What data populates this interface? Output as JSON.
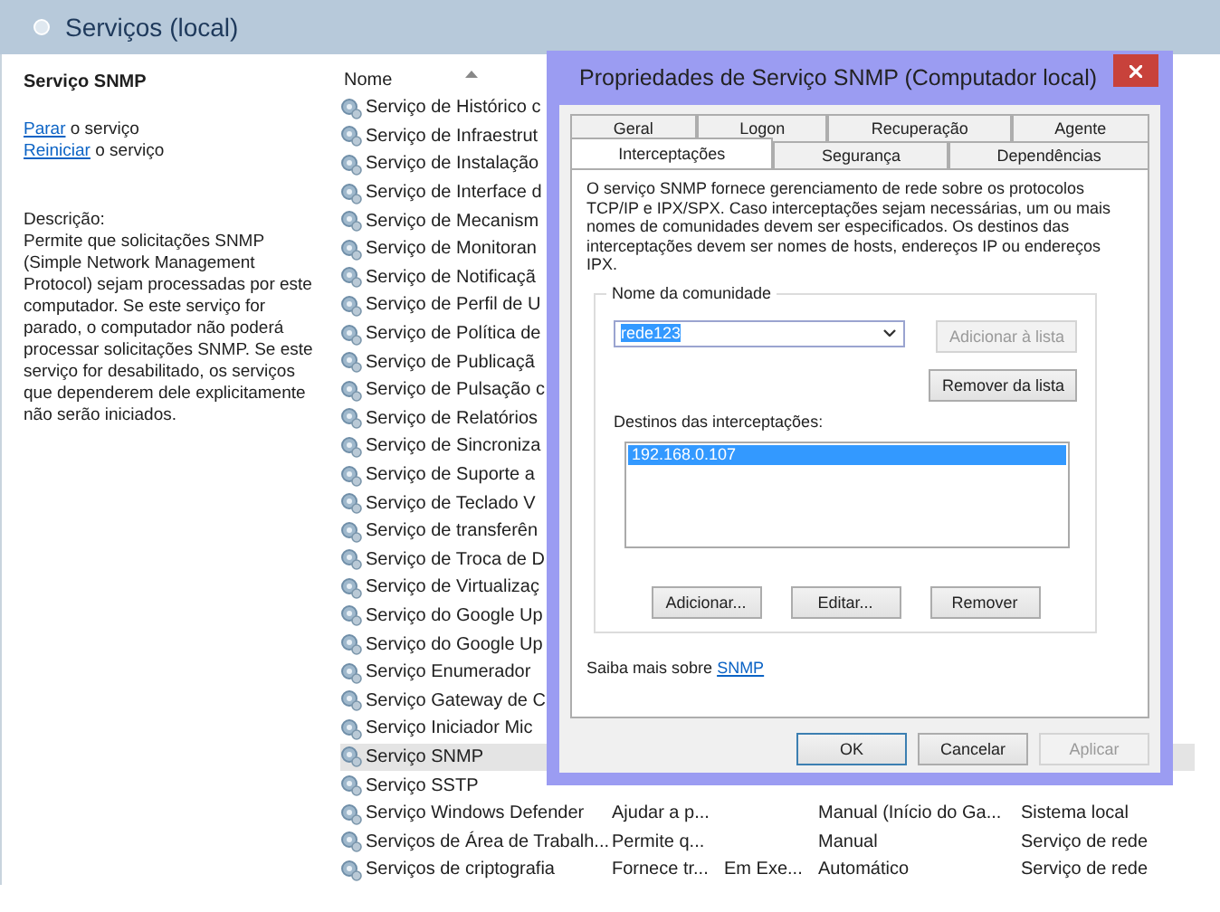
{
  "header": {
    "title": "Serviços (local)"
  },
  "details": {
    "title": "Serviço SNMP",
    "actions": [
      {
        "link": "Parar",
        "text": "o serviço"
      },
      {
        "link": "Reiniciar",
        "text": "o serviço"
      }
    ],
    "description_label": "Descrição:",
    "description": "Permite que solicitações SNMP (Simple Network Management Protocol) sejam processadas por este computador. Se este serviço for parado, o computador não poderá processar solicitações SNMP. Se este serviço for desabilitado, os serviços que dependerem dele explicitamente não serão iniciados."
  },
  "table": {
    "columns": [
      "Nome"
    ],
    "rows": [
      {
        "name": "Serviço de Histórico c",
        "selected": false
      },
      {
        "name": "Serviço de Infraestrut",
        "selected": false
      },
      {
        "name": "Serviço de Instalação",
        "selected": false
      },
      {
        "name": "Serviço de Interface d",
        "selected": false
      },
      {
        "name": "Serviço de Mecanism",
        "selected": false
      },
      {
        "name": "Serviço de Monitoran",
        "selected": false
      },
      {
        "name": "Serviço de Notificaçã",
        "selected": false
      },
      {
        "name": "Serviço de Perfil de U",
        "selected": false
      },
      {
        "name": "Serviço de Política de",
        "selected": false
      },
      {
        "name": "Serviço de Publicaçã",
        "selected": false
      },
      {
        "name": "Serviço de Pulsação c",
        "selected": false
      },
      {
        "name": "Serviço de Relatórios",
        "selected": false
      },
      {
        "name": "Serviço de Sincroniza",
        "selected": false
      },
      {
        "name": "Serviço de Suporte a",
        "selected": false
      },
      {
        "name": "Serviço de Teclado V",
        "selected": false
      },
      {
        "name": "Serviço de transferên",
        "selected": false
      },
      {
        "name": "Serviço de Troca de D",
        "selected": false
      },
      {
        "name": "Serviço de Virtualizaç",
        "selected": false
      },
      {
        "name": "Serviço do Google Up",
        "selected": false
      },
      {
        "name": "Serviço do Google Up",
        "selected": false
      },
      {
        "name": "Serviço Enumerador",
        "selected": false
      },
      {
        "name": "Serviço Gateway de C",
        "selected": false
      },
      {
        "name": "Serviço Iniciador Mic",
        "selected": false
      },
      {
        "name": "Serviço SNMP",
        "selected": true
      },
      {
        "name": "Serviço SSTP",
        "selected": false
      },
      {
        "name": "Serviço Windows Defender",
        "description": "Ajudar a p...",
        "startup": "Manual (Início do Ga...",
        "logon": "Sistema local",
        "selected": false
      },
      {
        "name": "Serviços de Área de Trabalh...",
        "description": "Permite q...",
        "startup": "Manual",
        "logon": "Serviço de rede",
        "selected": false
      },
      {
        "name": "Serviços de criptografia",
        "description": "Fornece tr...",
        "status": "Em Exe...",
        "startup": "Automático",
        "logon": "Serviço de rede",
        "selected": false
      }
    ]
  },
  "dialog": {
    "title": "Propriedades de Serviço SNMP (Computador local)",
    "tab_rows": [
      {
        "tabs": [
          {
            "label": "Geral",
            "selected": false
          },
          {
            "label": "Logon",
            "selected": false
          },
          {
            "label": "Recuperação",
            "selected": false
          },
          {
            "label": "Agente",
            "selected": false
          }
        ]
      },
      {
        "tabs": [
          {
            "label": "Interceptações",
            "selected": true
          },
          {
            "label": "Segurança",
            "selected": false
          },
          {
            "label": "Dependências",
            "selected": false
          }
        ]
      }
    ],
    "intro": "O serviço SNMP fornece gerenciamento de rede sobre os protocolos TCP/IP e IPX/SPX. Caso interceptações sejam necessárias, um ou mais nomes de comunidades devem ser especificados. Os destinos das interceptações devem ser nomes de hosts, endereços IP ou endereços IPX.",
    "community_group": "Nome da comunidade",
    "community_value": "rede123",
    "add_to_list": {
      "label": "Adicionar à lista",
      "disabled": true
    },
    "remove_from_list": {
      "label": "Remover da lista",
      "disabled": false
    },
    "destinations_label": "Destinos das interceptações:",
    "destinations": [
      {
        "label": "192.168.0.107",
        "selected": true
      }
    ],
    "list_buttons": [
      {
        "label": "Adicionar...",
        "disabled": false
      },
      {
        "label": "Editar...",
        "disabled": false
      },
      {
        "label": "Remover",
        "disabled": false
      }
    ],
    "learn_more": {
      "text": "Saiba mais sobre",
      "link": "SNMP"
    },
    "buttons": [
      {
        "label": "OK",
        "default": true,
        "disabled": false
      },
      {
        "label": "Cancelar",
        "default": false,
        "disabled": false
      },
      {
        "label": "Aplicar",
        "default": false,
        "disabled": true
      }
    ]
  }
}
